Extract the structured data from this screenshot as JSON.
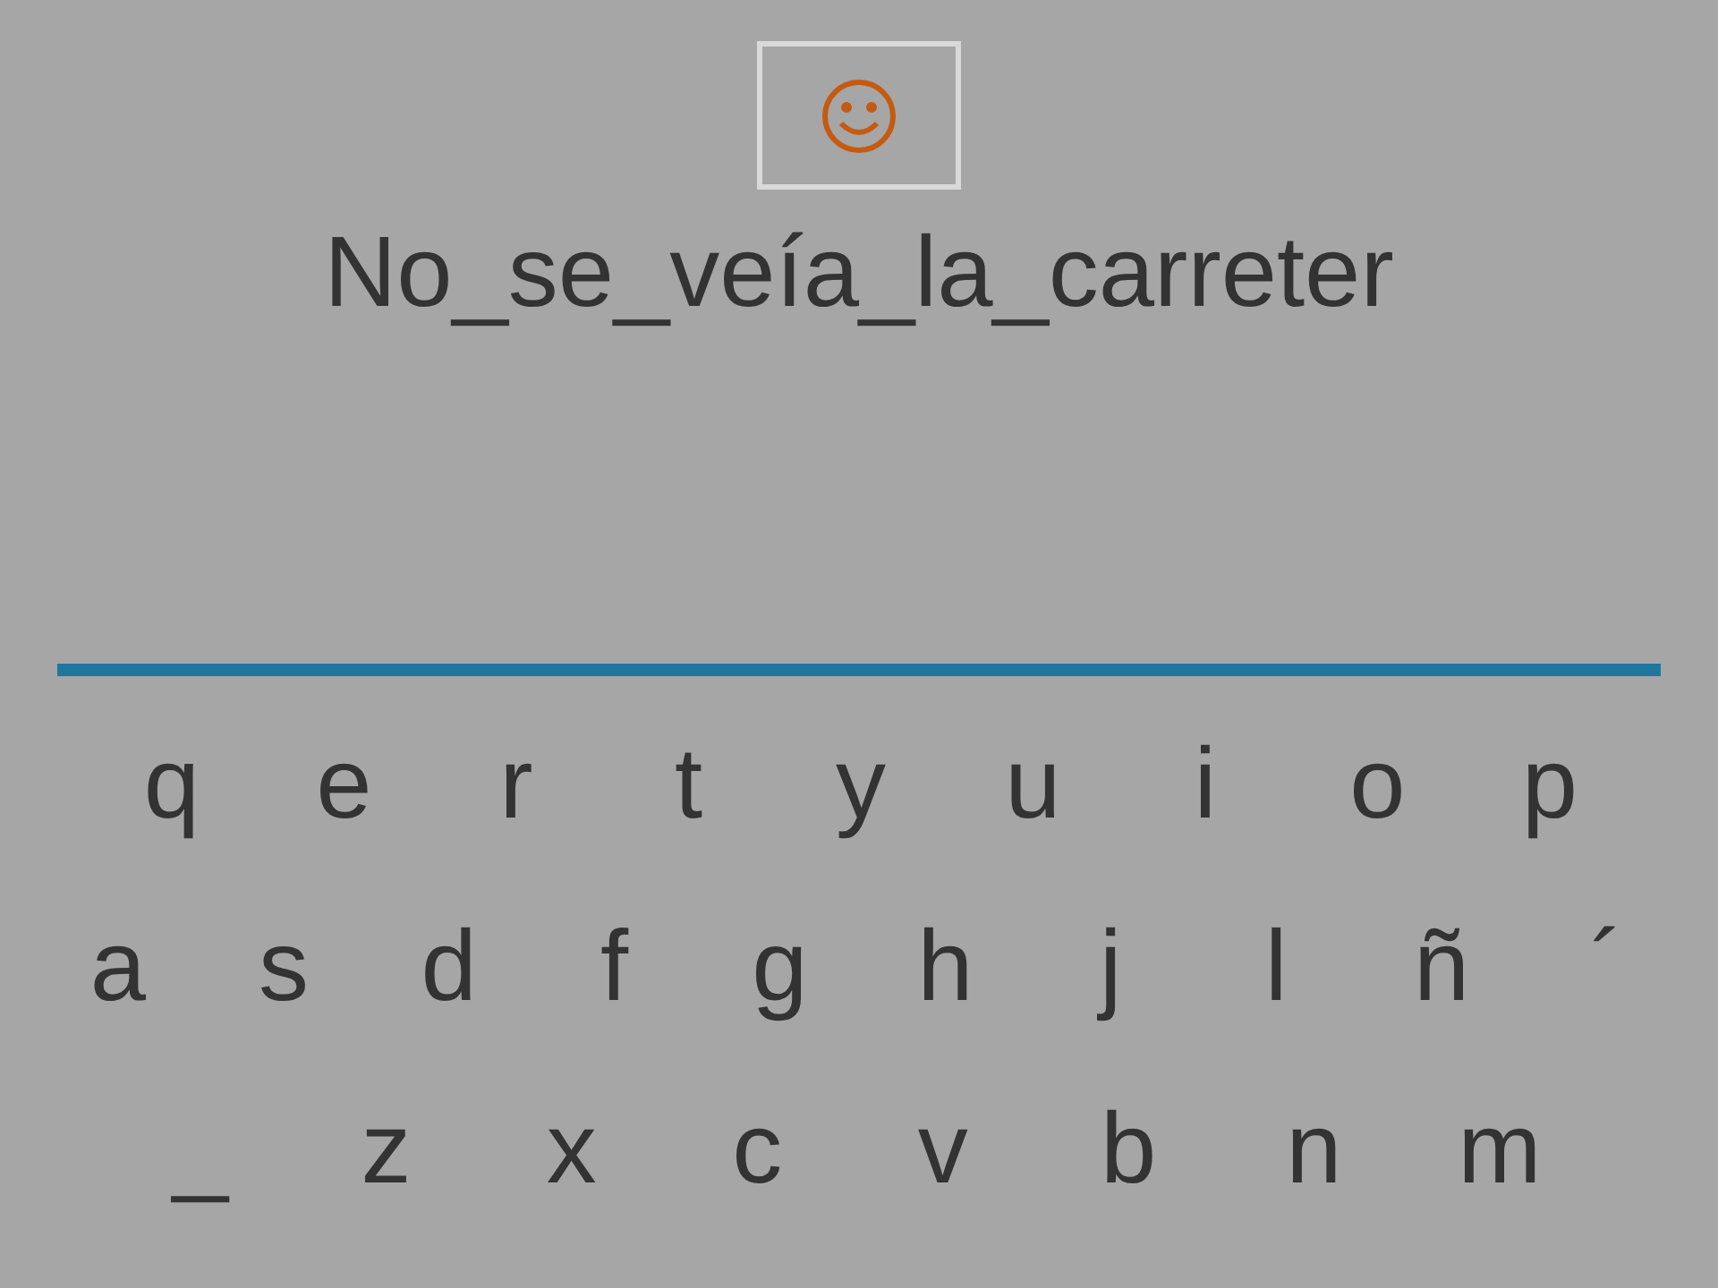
{
  "prompt": "No_se_veía_la_carreter",
  "keyboard": [
    [
      "q",
      "e",
      "r",
      "t",
      "y",
      "u",
      "i",
      "o",
      "p"
    ],
    [
      "a",
      "s",
      "d",
      "f",
      "g",
      "h",
      "j",
      "l",
      "ñ",
      "´"
    ],
    [
      "_",
      "z",
      "x",
      "c",
      "v",
      "b",
      "n",
      "m"
    ]
  ]
}
